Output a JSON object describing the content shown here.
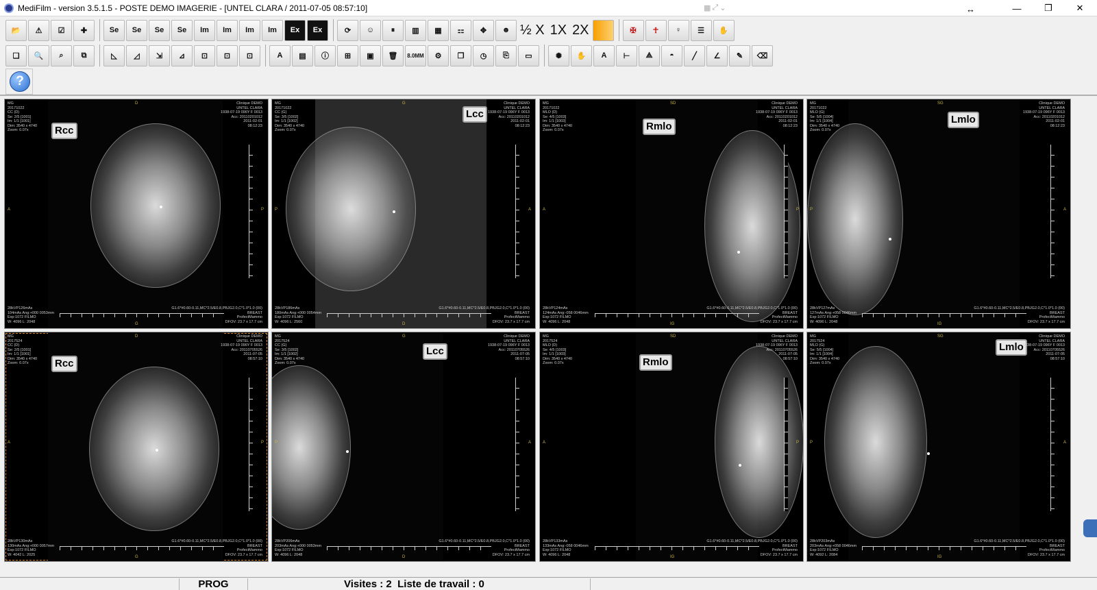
{
  "window": {
    "title": "MediFilm - version 3.5.1.5  - POSTE DEMO IMAGERIE - [UNTEL CLARA / 2011-07-05 08:57:10]",
    "min": "—",
    "max": "❐",
    "close": "✕"
  },
  "toolbar": {
    "row1": [
      "open",
      "warning",
      "checklist",
      "add",
      "Se",
      "Se",
      "Se",
      "Se",
      "Im",
      "Im",
      "Im",
      "Im",
      "Ex",
      "Ex",
      "sync",
      "person",
      "pause",
      "layout",
      "grid",
      "compare",
      "move",
      "patient"
    ],
    "zoom_half": "½",
    "zoom_x": "X",
    "zoom_1x": "1X",
    "zoom_2x": "2X",
    "row2_label_mm": "8.0MM",
    "help": "?"
  },
  "panes": [
    {
      "marker": "Rcc",
      "tl": "MG\n20171022\nCC (D)\nSe: 2/5 [1001]\nIm: 1/1 [1001]\nDim: 3540 x 4740\nZoom: 0.07x",
      "tr": "Clinique DEMO\nUNTEL CLARA\n1938-07-19 096Y F 0013\nAcc: 20110201012\n2011-02-01\n08:12:23",
      "bl": "28kVP126mAs\n104mAs Ang:+000 0053mm\nExp:1072 FILMO\nW: 4096 L: 2048",
      "br": "G1.6*#0.60-0.11,MC*2.5/E0.8,PBJG2.0,C*1.0*1.0 (00)\nBREAST\nProfectMammo\nDFOV: 23.7 x 17.7 cm",
      "top": "D",
      "bottom": "G",
      "left": "A",
      "right": "P"
    },
    {
      "marker": "Lcc",
      "tl": "MG\n20171022\nCC (G)\nSe: 3/5 [1002]\nIm: 1/1 [1002]\nDim: 3540 x 4740\nZoom: 0.07x",
      "tr": "Clinique DEMO\nUNTEL CLARA\n1938-07-19 096Y F 0013\nAcc: 20110201012\n2011-02-01\n08:12:23",
      "bl": "28kVP186mAs\n180mAs Ang:+000 0054mm\nExp:1072 FILMO\nW: 4096 L: 2560",
      "br": "G1.6*#0.60-0.11,MC*2.5/E0.8,PBJG2.0,C*1.0*1.0 (00)\nBREAST\nProfectMammo\nDFOV: 23.7 x 17.7 cm",
      "top": "G",
      "bottom": "D",
      "left": "P",
      "right": "A"
    },
    {
      "marker": "Rmlo",
      "tl": "MG\n20171022\nMLO (D)\nSe: 4/5 [1003]\nIm: 1/1 [1003]\nDim: 3540 x 4740\nZoom: 0.07x",
      "tr": "Clinique DEMO\nUNTEL CLARA\n1938-07-19 096Y F 0013\nAcc: 20110201012\n2011-02-01\n08:12:23",
      "bl": "28kVP124mAs\n124mAs Ang:-058 0046mm\nExp:1072 FILMO\nW: 4096 L: 2048",
      "br": "G1.6*#0.60-0.11,MC*2.5/E0.8,PBJG2.0,C*1.0*1.0 (00)\nBREAST\nProfectMammo\nDFOV: 23.7 x 17.7 cm",
      "top": "SD",
      "bottom": "IG",
      "left": "A",
      "right": "P"
    },
    {
      "marker": "Lmlo",
      "tl": "MG\n20171022\nMLO (G)\nSe: 5/5 [1004]\nIm: 1/1 [1004]\nDim: 3540 x 4740\nZoom: 0.07x",
      "tr": "Clinique DEMO\nUNTEL CLARA\n1938-07-19 096Y F 0013\nAcc: 20110201012\n2011-02-01\n08:12:23",
      "bl": "28kVP127mAs\n127mAs Ang:+058 0046mm\nExp:1072 FILMO\nW: 4096 L: 2048",
      "br": "G1.6*#0.60-0.11,MC*2.5/E0.8,PBJG2.0,C*1.0*1.0 (00)\nBREAST\nProfectMammo\nDFOV: 23.7 x 17.7 cm",
      "top": "SG",
      "bottom": "IG",
      "left": "P",
      "right": "A"
    },
    {
      "marker": "Rcc",
      "tl": "MG\n2017524\nCC (D)\nSe: 2/5 [1001]\nIm: 1/1 [1001]\nDim: 3540 x 4740\nZoom: 0.07x",
      "tr": "Clinique DEMO\nUNTEL CLARA\n1938-07-19 096Y F 0013\nAcc: 20110705526\n2011-07-05\n08:57:10",
      "bl": "28kVP130mAs\n130mAs Ang:+000 0057mm\nExp:1072 FILMO\nW: 4042 L: 2025",
      "br": "G1.6*#0.60-0.11,MC*2.5/E0.8,PBJG2.0,C*1.0*1.0 (00)\nBREAST\nProfectMammo\nDFOV: 23.7 x 17.7 cm",
      "top": "D",
      "bottom": "G",
      "left": "A",
      "right": "P"
    },
    {
      "marker": "Lcc",
      "tl": "MG\n2017524\nCC (G)\nSe: 3/5 [1002]\nIm: 1/1 [1002]\nDim: 3540 x 4740\nZoom: 0.07x",
      "tr": "Clinique DEMO\nUNTEL CLARA\n1938-07-19 096Y F 0013\nAcc: 20110705526\n2011-07-05\n08:57:10",
      "bl": "28kVP206mAs\n203mAs Ang:+000 0053mm\nExp:1072 FILMO\nW: 4096 L: 2048",
      "br": "G1.6*#0.60-0.11,MC*2.5/E0.8,PBJG2.0,C*1.0*1.0 (00)\nBREAST\nProfectMammo\nDFOV: 23.7 x 17.7 cm",
      "top": "G",
      "bottom": "D",
      "left": "P",
      "right": "A"
    },
    {
      "marker": "Rmlo",
      "tl": "MG\n2017524\nMLO (D)\nSe: 4/5 [1003]\nIm: 1/1 [1003]\nDim: 3540 x 4740\nZoom: 0.07x",
      "tr": "Clinique DEMO\nUNTEL CLARA\n1938-07-19 096Y F 0013\nAcc: 20110705526\n2011-07-05\n08:57:10",
      "bl": "28kVP133mAs\n133mAs Ang:-058 0046mm\nExp:1072 FILMO\nW: 4096 L: 2048",
      "br": "G1.6*#0.60-0.11,MC*2.5/E0.8,PBJG2.0,C*1.0*1.0 (00)\nBREAST\nProfectMammo\nDFOV: 23.7 x 17.7 cm",
      "top": "SD",
      "bottom": "IG",
      "left": "A",
      "right": "P"
    },
    {
      "marker": "Lmlo",
      "tl": "MG\n2017524\nMLO (G)\nSe: 5/5 [1004]\nIm: 1/1 [1004]\nDim: 3540 x 4740\nZoom: 0.07x",
      "tr": "Clinique DEMO\nUNTEL CLARA\n1938-07-19 096Y F 0013\nAcc: 20110705526\n2011-07-05\n08:57:10",
      "bl": "28kVP203mAs\n203mAs Ang:+058 0046mm\nExp:1072 FILMO\nW: 4092 L: 2084",
      "br": "G1.6*#0.60-0.11,MC*2.5/E0.8,PBJG2.0,C*1.0*1.0 (00)\nBREAST\nProfectMammo\nDFOV: 23.7 x 17.7 cm",
      "top": "SG",
      "bottom": "IG",
      "left": "P",
      "right": "A"
    }
  ],
  "status": {
    "mode": "PROG",
    "visits_label": "Visites : 2",
    "worklist_label": "Liste de travail : 0"
  }
}
